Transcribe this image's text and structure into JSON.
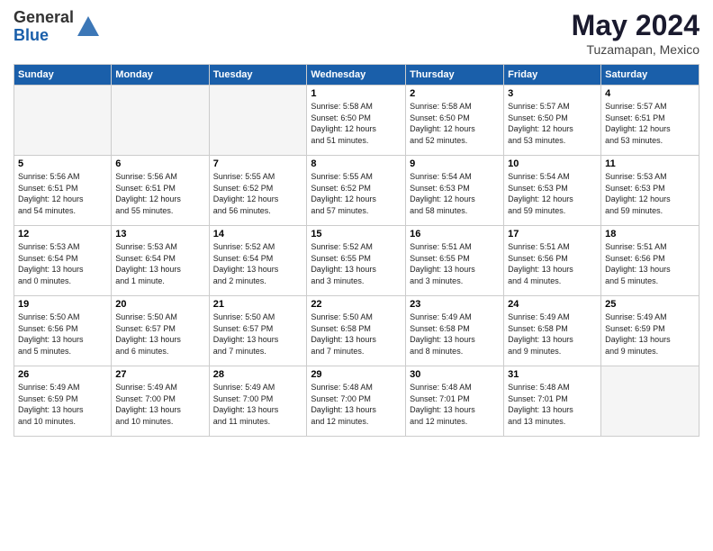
{
  "header": {
    "logo_general": "General",
    "logo_blue": "Blue",
    "month_title": "May 2024",
    "location": "Tuzamapan, Mexico"
  },
  "days_of_week": [
    "Sunday",
    "Monday",
    "Tuesday",
    "Wednesday",
    "Thursday",
    "Friday",
    "Saturday"
  ],
  "weeks": [
    [
      {
        "day": "",
        "info": "",
        "empty": true
      },
      {
        "day": "",
        "info": "",
        "empty": true
      },
      {
        "day": "",
        "info": "",
        "empty": true
      },
      {
        "day": "1",
        "info": "Sunrise: 5:58 AM\nSunset: 6:50 PM\nDaylight: 12 hours\nand 51 minutes.",
        "empty": false
      },
      {
        "day": "2",
        "info": "Sunrise: 5:58 AM\nSunset: 6:50 PM\nDaylight: 12 hours\nand 52 minutes.",
        "empty": false
      },
      {
        "day": "3",
        "info": "Sunrise: 5:57 AM\nSunset: 6:50 PM\nDaylight: 12 hours\nand 53 minutes.",
        "empty": false
      },
      {
        "day": "4",
        "info": "Sunrise: 5:57 AM\nSunset: 6:51 PM\nDaylight: 12 hours\nand 53 minutes.",
        "empty": false
      }
    ],
    [
      {
        "day": "5",
        "info": "Sunrise: 5:56 AM\nSunset: 6:51 PM\nDaylight: 12 hours\nand 54 minutes.",
        "empty": false
      },
      {
        "day": "6",
        "info": "Sunrise: 5:56 AM\nSunset: 6:51 PM\nDaylight: 12 hours\nand 55 minutes.",
        "empty": false
      },
      {
        "day": "7",
        "info": "Sunrise: 5:55 AM\nSunset: 6:52 PM\nDaylight: 12 hours\nand 56 minutes.",
        "empty": false
      },
      {
        "day": "8",
        "info": "Sunrise: 5:55 AM\nSunset: 6:52 PM\nDaylight: 12 hours\nand 57 minutes.",
        "empty": false
      },
      {
        "day": "9",
        "info": "Sunrise: 5:54 AM\nSunset: 6:53 PM\nDaylight: 12 hours\nand 58 minutes.",
        "empty": false
      },
      {
        "day": "10",
        "info": "Sunrise: 5:54 AM\nSunset: 6:53 PM\nDaylight: 12 hours\nand 59 minutes.",
        "empty": false
      },
      {
        "day": "11",
        "info": "Sunrise: 5:53 AM\nSunset: 6:53 PM\nDaylight: 12 hours\nand 59 minutes.",
        "empty": false
      }
    ],
    [
      {
        "day": "12",
        "info": "Sunrise: 5:53 AM\nSunset: 6:54 PM\nDaylight: 13 hours\nand 0 minutes.",
        "empty": false
      },
      {
        "day": "13",
        "info": "Sunrise: 5:53 AM\nSunset: 6:54 PM\nDaylight: 13 hours\nand 1 minute.",
        "empty": false
      },
      {
        "day": "14",
        "info": "Sunrise: 5:52 AM\nSunset: 6:54 PM\nDaylight: 13 hours\nand 2 minutes.",
        "empty": false
      },
      {
        "day": "15",
        "info": "Sunrise: 5:52 AM\nSunset: 6:55 PM\nDaylight: 13 hours\nand 3 minutes.",
        "empty": false
      },
      {
        "day": "16",
        "info": "Sunrise: 5:51 AM\nSunset: 6:55 PM\nDaylight: 13 hours\nand 3 minutes.",
        "empty": false
      },
      {
        "day": "17",
        "info": "Sunrise: 5:51 AM\nSunset: 6:56 PM\nDaylight: 13 hours\nand 4 minutes.",
        "empty": false
      },
      {
        "day": "18",
        "info": "Sunrise: 5:51 AM\nSunset: 6:56 PM\nDaylight: 13 hours\nand 5 minutes.",
        "empty": false
      }
    ],
    [
      {
        "day": "19",
        "info": "Sunrise: 5:50 AM\nSunset: 6:56 PM\nDaylight: 13 hours\nand 5 minutes.",
        "empty": false
      },
      {
        "day": "20",
        "info": "Sunrise: 5:50 AM\nSunset: 6:57 PM\nDaylight: 13 hours\nand 6 minutes.",
        "empty": false
      },
      {
        "day": "21",
        "info": "Sunrise: 5:50 AM\nSunset: 6:57 PM\nDaylight: 13 hours\nand 7 minutes.",
        "empty": false
      },
      {
        "day": "22",
        "info": "Sunrise: 5:50 AM\nSunset: 6:58 PM\nDaylight: 13 hours\nand 7 minutes.",
        "empty": false
      },
      {
        "day": "23",
        "info": "Sunrise: 5:49 AM\nSunset: 6:58 PM\nDaylight: 13 hours\nand 8 minutes.",
        "empty": false
      },
      {
        "day": "24",
        "info": "Sunrise: 5:49 AM\nSunset: 6:58 PM\nDaylight: 13 hours\nand 9 minutes.",
        "empty": false
      },
      {
        "day": "25",
        "info": "Sunrise: 5:49 AM\nSunset: 6:59 PM\nDaylight: 13 hours\nand 9 minutes.",
        "empty": false
      }
    ],
    [
      {
        "day": "26",
        "info": "Sunrise: 5:49 AM\nSunset: 6:59 PM\nDaylight: 13 hours\nand 10 minutes.",
        "empty": false
      },
      {
        "day": "27",
        "info": "Sunrise: 5:49 AM\nSunset: 7:00 PM\nDaylight: 13 hours\nand 10 minutes.",
        "empty": false
      },
      {
        "day": "28",
        "info": "Sunrise: 5:49 AM\nSunset: 7:00 PM\nDaylight: 13 hours\nand 11 minutes.",
        "empty": false
      },
      {
        "day": "29",
        "info": "Sunrise: 5:48 AM\nSunset: 7:00 PM\nDaylight: 13 hours\nand 12 minutes.",
        "empty": false
      },
      {
        "day": "30",
        "info": "Sunrise: 5:48 AM\nSunset: 7:01 PM\nDaylight: 13 hours\nand 12 minutes.",
        "empty": false
      },
      {
        "day": "31",
        "info": "Sunrise: 5:48 AM\nSunset: 7:01 PM\nDaylight: 13 hours\nand 13 minutes.",
        "empty": false
      },
      {
        "day": "",
        "info": "",
        "empty": true
      }
    ]
  ]
}
